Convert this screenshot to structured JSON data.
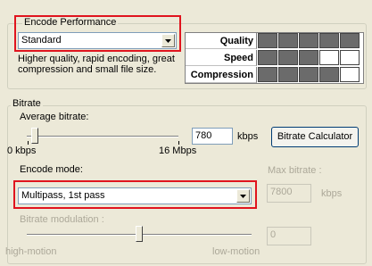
{
  "encode_performance": {
    "legend": "Encode Performance",
    "preset_value": "Standard",
    "description": "Higher quality, rapid encoding, great compression and small file size.",
    "grid": [
      {
        "label": "Quality",
        "cells": [
          1,
          1,
          1,
          1,
          1
        ]
      },
      {
        "label": "Speed",
        "cells": [
          1,
          1,
          1,
          0,
          0
        ]
      },
      {
        "label": "Compression",
        "cells": [
          1,
          1,
          1,
          1,
          0
        ]
      }
    ]
  },
  "bitrate": {
    "legend": "Bitrate",
    "average_label": "Average bitrate:",
    "average_value": "780",
    "unit": "kbps",
    "calc_button": "Bitrate Calculator",
    "min_label": "0 kbps",
    "max_label": "16 Mbps",
    "average_fraction": 0.05,
    "encode_mode_label": "Encode mode:",
    "encode_mode_value": "Multipass, 1st pass",
    "max_bitrate_label": "Max bitrate :",
    "max_bitrate_value": "7800",
    "max_bitrate_unit": "kbps",
    "modulation_label": "Bitrate modulation :",
    "mod_left": "high-motion",
    "mod_right": "low-motion",
    "modulation_value": "0",
    "modulation_fraction": 0.5
  }
}
